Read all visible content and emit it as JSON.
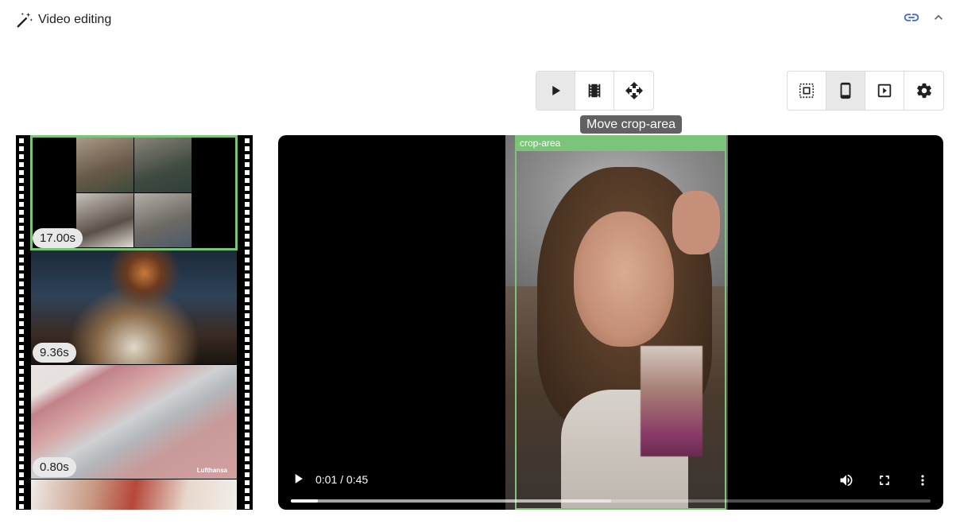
{
  "header": {
    "icon": "magic-wand-icon",
    "title": "Video editing",
    "actions": [
      {
        "icon": "link-icon"
      },
      {
        "icon": "chevron-up-icon"
      }
    ]
  },
  "mode_toolbar": {
    "buttons": [
      {
        "icon": "play-icon",
        "active": true
      },
      {
        "icon": "film-icon",
        "active": false
      },
      {
        "icon": "move-icon",
        "active": false
      }
    ]
  },
  "format_toolbar": {
    "buttons": [
      {
        "icon": "crop-free-icon",
        "active": false
      },
      {
        "icon": "phone-portrait-icon",
        "active": true
      },
      {
        "icon": "slideshow-icon",
        "active": false
      },
      {
        "icon": "gear-icon",
        "active": false
      }
    ]
  },
  "tooltip": {
    "text": "Move crop-area"
  },
  "filmstrip": {
    "scenes": [
      {
        "duration": "17.00s",
        "selected": true
      },
      {
        "duration": "9.36s",
        "selected": false
      },
      {
        "duration": "0.80s",
        "selected": false
      },
      {
        "duration": "",
        "selected": false
      }
    ],
    "watermark": "Lufthansa"
  },
  "video": {
    "crop_label": "crop-area",
    "time": "0:01 / 0:45",
    "progress_played": 0.042,
    "progress_buffered": 0.5
  },
  "colors": {
    "accent_green": "#7cc47a",
    "toolbar_active": "#e8e8e8",
    "tooltip_bg": "#616161"
  }
}
